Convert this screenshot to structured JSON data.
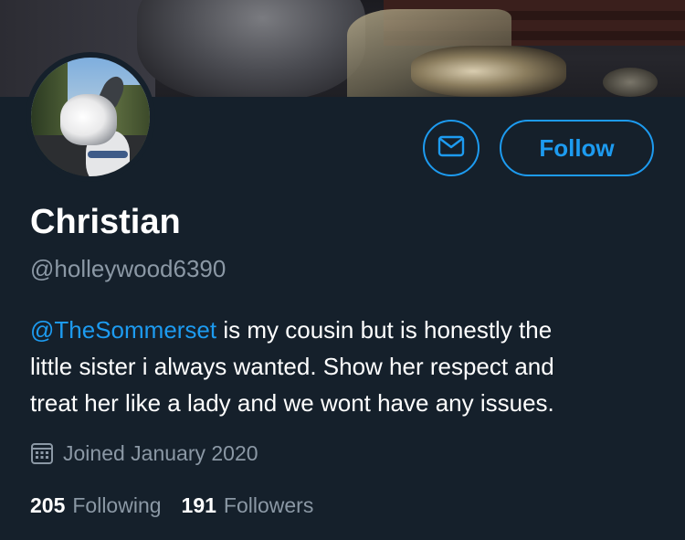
{
  "profile": {
    "display_name": "Christian",
    "handle": "@holleywood6390",
    "bio": {
      "mention": "@TheSommerset",
      "line1_rest": " is my cousin but is honestly the",
      "line2": "little sister i always wanted. Show her respect and",
      "line3": "treat her like a lady and we wont have any issues."
    },
    "joined": "Joined January 2020",
    "following_count": "205",
    "following_label": "Following",
    "followers_count": "191",
    "followers_label": "Followers"
  },
  "actions": {
    "message_icon": "envelope-icon",
    "follow_label": "Follow"
  },
  "icons": {
    "joined": "calendar-icon"
  },
  "colors": {
    "background": "#15202b",
    "accent": "#1d9bf0",
    "secondary_text": "#8b98a5",
    "primary_text": "#ffffff"
  }
}
